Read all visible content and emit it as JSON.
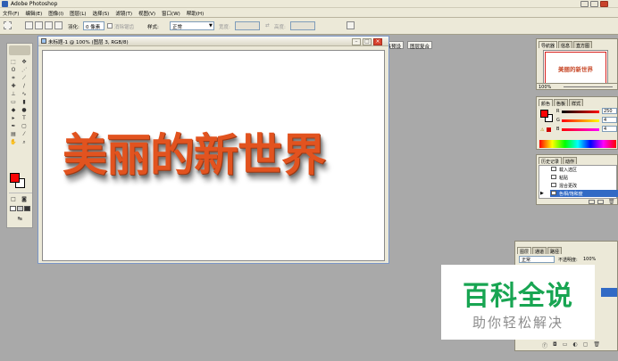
{
  "app": {
    "title": "Adobe Photoshop"
  },
  "menu": [
    "文件(F)",
    "编辑(E)",
    "图像(I)",
    "图层(L)",
    "选择(S)",
    "滤镜(T)",
    "视图(V)",
    "窗口(W)",
    "帮助(H)"
  ],
  "options": {
    "feather_label": "羽化:",
    "feather_value": "0 像素",
    "antialias_label": "消除锯齿",
    "style_label": "样式:",
    "style_value": "正常",
    "width_label": "宽度:",
    "height_label": "高度:",
    "palette_tabs": [
      "画笔",
      "工具预设",
      "图层复合"
    ]
  },
  "document": {
    "title": "未标题-1 @ 100% (图层 3, RGB/8)",
    "canvas_text": "美丽的新世界"
  },
  "navigator": {
    "tabs": [
      "导航器",
      "信息",
      "直方图"
    ],
    "thumb_text": "美丽的新世界",
    "zoom": "100%"
  },
  "color_panel": {
    "tabs": [
      "颜色",
      "色板",
      "样式"
    ],
    "channels": [
      {
        "label": "R",
        "value": "250"
      },
      {
        "label": "G",
        "value": "4"
      },
      {
        "label": "B",
        "value": "4"
      }
    ],
    "fg_color": "#fa0404"
  },
  "history": {
    "tabs": [
      "历史记录",
      "动作"
    ],
    "items": [
      {
        "label": "载入选区"
      },
      {
        "label": "粘贴"
      },
      {
        "label": "混合更改"
      },
      {
        "label": "色相/饱和度"
      }
    ]
  },
  "layers": {
    "tabs": [
      "图层",
      "通道",
      "路径"
    ],
    "blend_mode": "正常",
    "opacity_label": "不透明度:",
    "opacity_value": "100%"
  },
  "watermark": {
    "title": "百科全说",
    "subtitle": "助你轻松解决"
  }
}
